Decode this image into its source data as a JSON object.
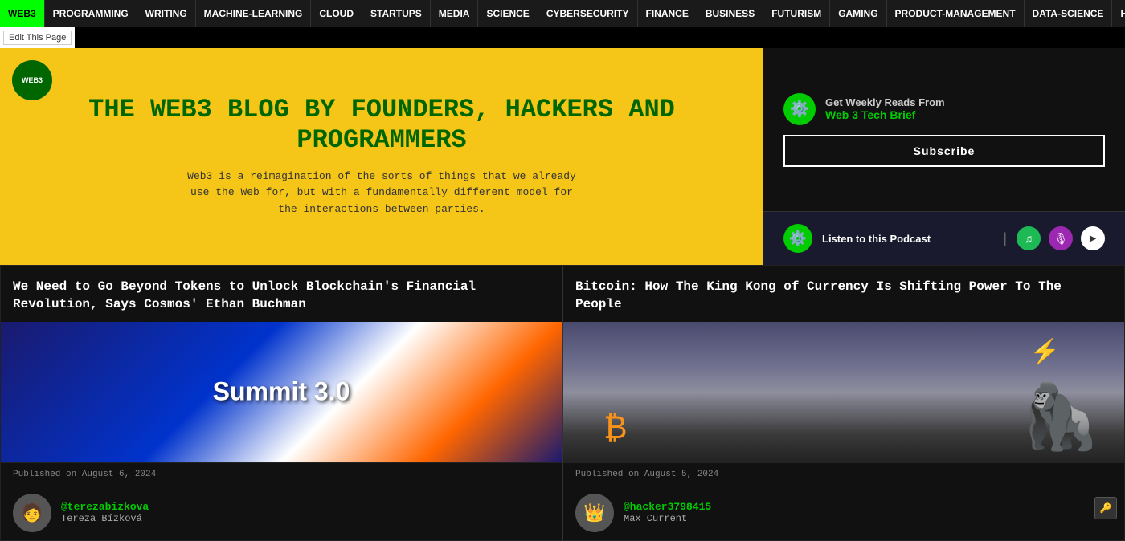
{
  "nav": {
    "items": [
      {
        "id": "web3",
        "label": "WEB3",
        "active": true
      },
      {
        "id": "programming",
        "label": "PROGRAMMING",
        "active": false
      },
      {
        "id": "writing",
        "label": "WRITING",
        "active": false
      },
      {
        "id": "machine-learning",
        "label": "MACHINE-LEARNING",
        "active": false
      },
      {
        "id": "cloud",
        "label": "CLOUD",
        "active": false
      },
      {
        "id": "startups",
        "label": "STARTUPS",
        "active": false
      },
      {
        "id": "media",
        "label": "MEDIA",
        "active": false
      },
      {
        "id": "science",
        "label": "SCIENCE",
        "active": false
      },
      {
        "id": "cybersecurity",
        "label": "CYBERSECURITY",
        "active": false
      },
      {
        "id": "finance",
        "label": "FINANCE",
        "active": false
      },
      {
        "id": "business",
        "label": "BUSINESS",
        "active": false
      },
      {
        "id": "futurism",
        "label": "FUTURISM",
        "active": false
      },
      {
        "id": "gaming",
        "label": "GAMING",
        "active": false
      },
      {
        "id": "product-management",
        "label": "PRODUCT-MANAGEMENT",
        "active": false
      },
      {
        "id": "data-science",
        "label": "DATA-SCIENCE",
        "active": false
      },
      {
        "id": "hackernoon",
        "label": "HACKERNOON",
        "active": false
      }
    ]
  },
  "edit_bar": {
    "label": "Edit This Page"
  },
  "hero": {
    "logo_text": "WEB3",
    "title": "THE WEB3 BLOG BY FOUNDERS, HACKERS AND PROGRAMMERS",
    "description": "Web3 is a reimagination of the sorts of things that we already use the Web for, but with a fundamentally different model for the interactions between parties."
  },
  "newsletter": {
    "label": "Get Weekly Reads From",
    "name": "Web 3 Tech Brief",
    "subscribe_label": "Subscribe"
  },
  "podcast": {
    "label": "Listen to this Podcast",
    "platforms": [
      "spotify",
      "apple",
      "google"
    ]
  },
  "articles": [
    {
      "title": "We Need to Go Beyond Tokens to Unlock Blockchain's Financial Revolution, Says Cosmos' Ethan Buchman",
      "image_type": "summit",
      "published": "Published on August 6, 2024",
      "author_handle": "@terezabizkova",
      "author_name": "Tereza Bízková",
      "author_emoji": "🧑"
    },
    {
      "title": "Bitcoin: How The King Kong of Currency Is Shifting Power To The People",
      "image_type": "kong",
      "published": "Published on August 5, 2024",
      "author_handle": "@hacker3798415",
      "author_name": "Max Current",
      "author_emoji": "👑"
    }
  ],
  "float_button": {
    "icon": "🔑"
  }
}
